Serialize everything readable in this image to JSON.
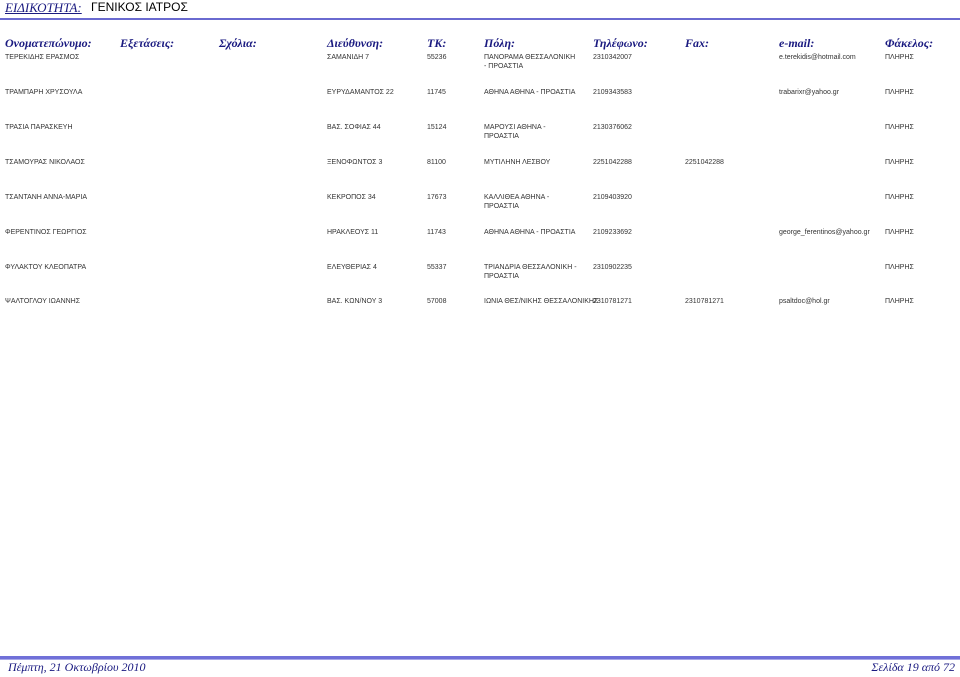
{
  "header": {
    "specialty_label": "ΕΙΔΙΚΟΤΗΤΑ:",
    "specialty_value": "ΓΕΝΙΚΟΣ ΙΑΤΡΟΣ"
  },
  "columns": [
    "Ονοματεπώνυμο:",
    "Εξετάσεις:",
    "Σχόλια:",
    "Διεύθυνση:",
    "ΤΚ:",
    "Πόλη:",
    "Τηλέφωνο:",
    "Fax:",
    "e-mail:",
    "Φάκελος:"
  ],
  "rows": [
    {
      "name": "ΤΕΡΕΚΙΔΗΣ ΕΡΑΣΜΟΣ",
      "address": "ΣΑΜΑΝΙΔΗ 7",
      "tk": "55236",
      "city": "ΠΑΝΟΡΑΜΑ ΘΕΣΣΑΛΟΝΙΚΗ - ΠΡΟΑΣΤΙΑ",
      "phone": "2310342007",
      "fax": "",
      "email": "e.terekidis@hotmail.com",
      "folder": "ΠΛΗΡΗΣ"
    },
    {
      "name": "ΤΡΑΜΠΑΡΗ ΧΡΥΣΟΥΛΑ",
      "address": "ΕΥΡΥΔΑΜΑΝΤΟΣ 22",
      "tk": "11745",
      "city": "ΑΘΗΝΑ ΑΘΗΝΑ - ΠΡΟΑΣΤΙΑ",
      "phone": "2109343583",
      "fax": "",
      "email": "trabarixr@yahoo.gr",
      "folder": "ΠΛΗΡΗΣ"
    },
    {
      "name": "ΤΡΑΣΙΑ ΠΑΡΑΣΚΕΥΗ",
      "address": "ΒΑΣ. ΣΟΦΙΑΣ 44",
      "tk": "15124",
      "city": "ΜΑΡΟΥΣΙ ΑΘΗΝΑ - ΠΡΟΑΣΤΙΑ",
      "phone": "2130376062",
      "fax": "",
      "email": "",
      "folder": "ΠΛΗΡΗΣ"
    },
    {
      "name": "ΤΣΑΜΟΥΡΑΣ ΝΙΚΟΛΑΟΣ",
      "address": "ΞΕΝΟΦΩΝΤΟΣ 3",
      "tk": "81100",
      "city": "ΜΥΤΙΛΗΝΗ ΛΕΣΒΟΥ",
      "phone": "2251042288",
      "fax": "2251042288",
      "email": "",
      "folder": "ΠΛΗΡΗΣ"
    },
    {
      "name": "ΤΣΑΝΤΑΝΗ ΑΝΝΑ-ΜΑΡΙΑ",
      "address": "ΚΕΚΡΟΠΟΣ 34",
      "tk": "17673",
      "city": "ΚΑΛΛΙΘΕΑ ΑΘΗΝΑ - ΠΡΟΑΣΤΙΑ",
      "phone": "2109403920",
      "fax": "",
      "email": "",
      "folder": "ΠΛΗΡΗΣ"
    },
    {
      "name": "ΦΕΡΕΝΤΙΝΟΣ ΓΕΩΡΓΙΟΣ",
      "address": "ΗΡΑΚΛΕΟΥΣ 11",
      "tk": "11743",
      "city": "ΑΘΗΝΑ ΑΘΗΝΑ - ΠΡΟΑΣΤΙΑ",
      "phone": "2109233692",
      "fax": "",
      "email": "george_ferentinos@yahoo.gr",
      "folder": "ΠΛΗΡΗΣ"
    },
    {
      "name": "ΦΥΛΑΚΤΟΥ ΚΛΕΟΠΑΤΡΑ",
      "address": "ΕΛΕΥΘΕΡΙΑΣ 4",
      "tk": "55337",
      "city": "ΤΡΙΑΝΔΡΙΑ ΘΕΣΣΑΛΟΝΙΚΗ - ΠΡΟΑΣΤΙΑ",
      "phone": "2310902235",
      "fax": "",
      "email": "",
      "folder": "ΠΛΗΡΗΣ"
    },
    {
      "name": "ΨΑΛΤΟΓΛΟΥ ΙΩΑΝΝΗΣ",
      "address": "ΒΑΣ. ΚΩΝ/ΝΟΥ 3",
      "tk": "57008",
      "city": "ΙΩΝΙΑ ΘΕΣ/ΝΙΚΗΣ ΘΕΣΣΑΛΟΝΙΚΗΣ",
      "phone": "2310781271",
      "fax": "2310781271",
      "email": "psaltdoc@hol.gr",
      "folder": "ΠΛΗΡΗΣ"
    }
  ],
  "footer": {
    "date": "Πέμπτη, 21 Οκτωβρίου 2010",
    "page": "Σελίδα 19 από 72"
  }
}
